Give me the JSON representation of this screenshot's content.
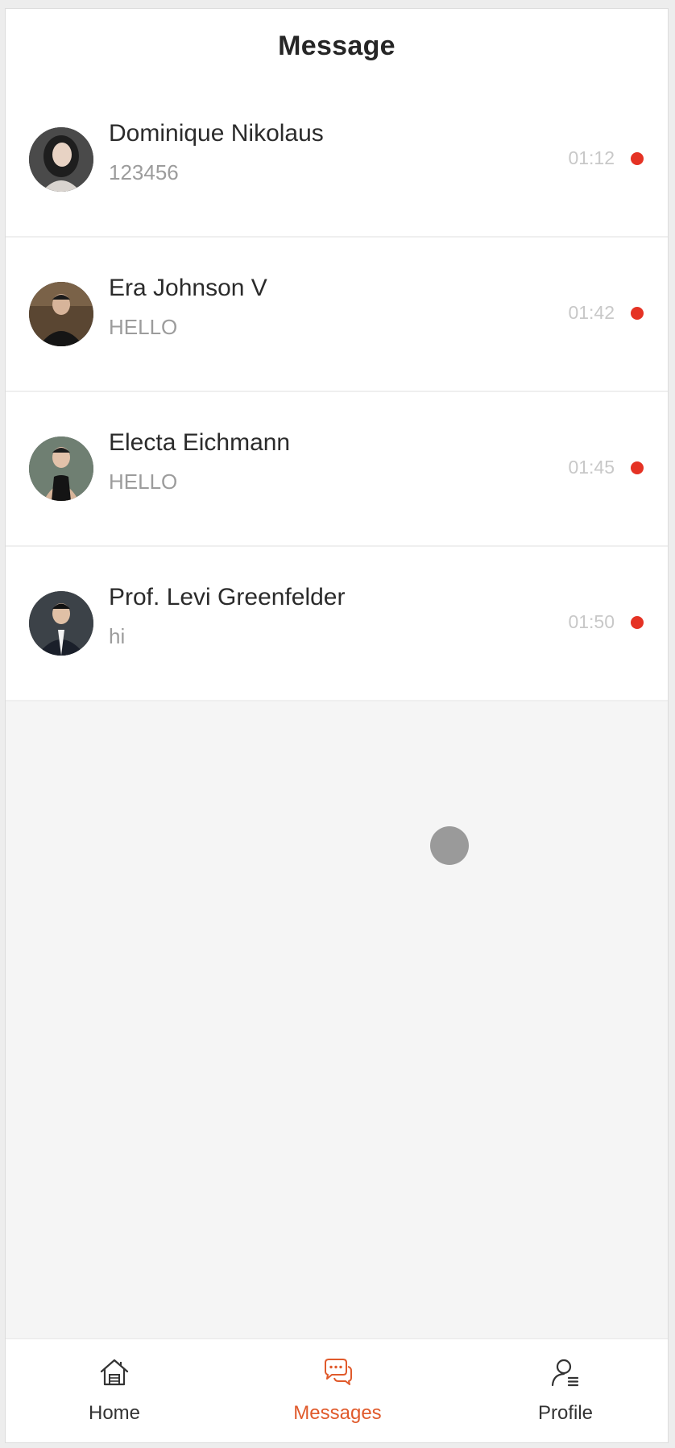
{
  "header": {
    "title": "Message"
  },
  "conversations": [
    {
      "name": "Dominique Nikolaus",
      "preview": "123456",
      "time": "01:12",
      "unread": true
    },
    {
      "name": "Era Johnson V",
      "preview": "HELLO",
      "time": "01:42",
      "unread": true
    },
    {
      "name": "Electa Eichmann",
      "preview": "HELLO",
      "time": "01:45",
      "unread": true
    },
    {
      "name": "Prof. Levi Greenfelder",
      "preview": "hi",
      "time": "01:50",
      "unread": true
    }
  ],
  "tabbar": {
    "items": [
      {
        "label": "Home",
        "icon": "home-icon",
        "active": false
      },
      {
        "label": "Messages",
        "icon": "chat-bubbles-icon",
        "active": true
      },
      {
        "label": "Profile",
        "icon": "user-profile-icon",
        "active": false
      }
    ]
  },
  "colors": {
    "accent": "#e05a2b",
    "unread_dot": "#e53224",
    "background": "#f5f5f5"
  }
}
